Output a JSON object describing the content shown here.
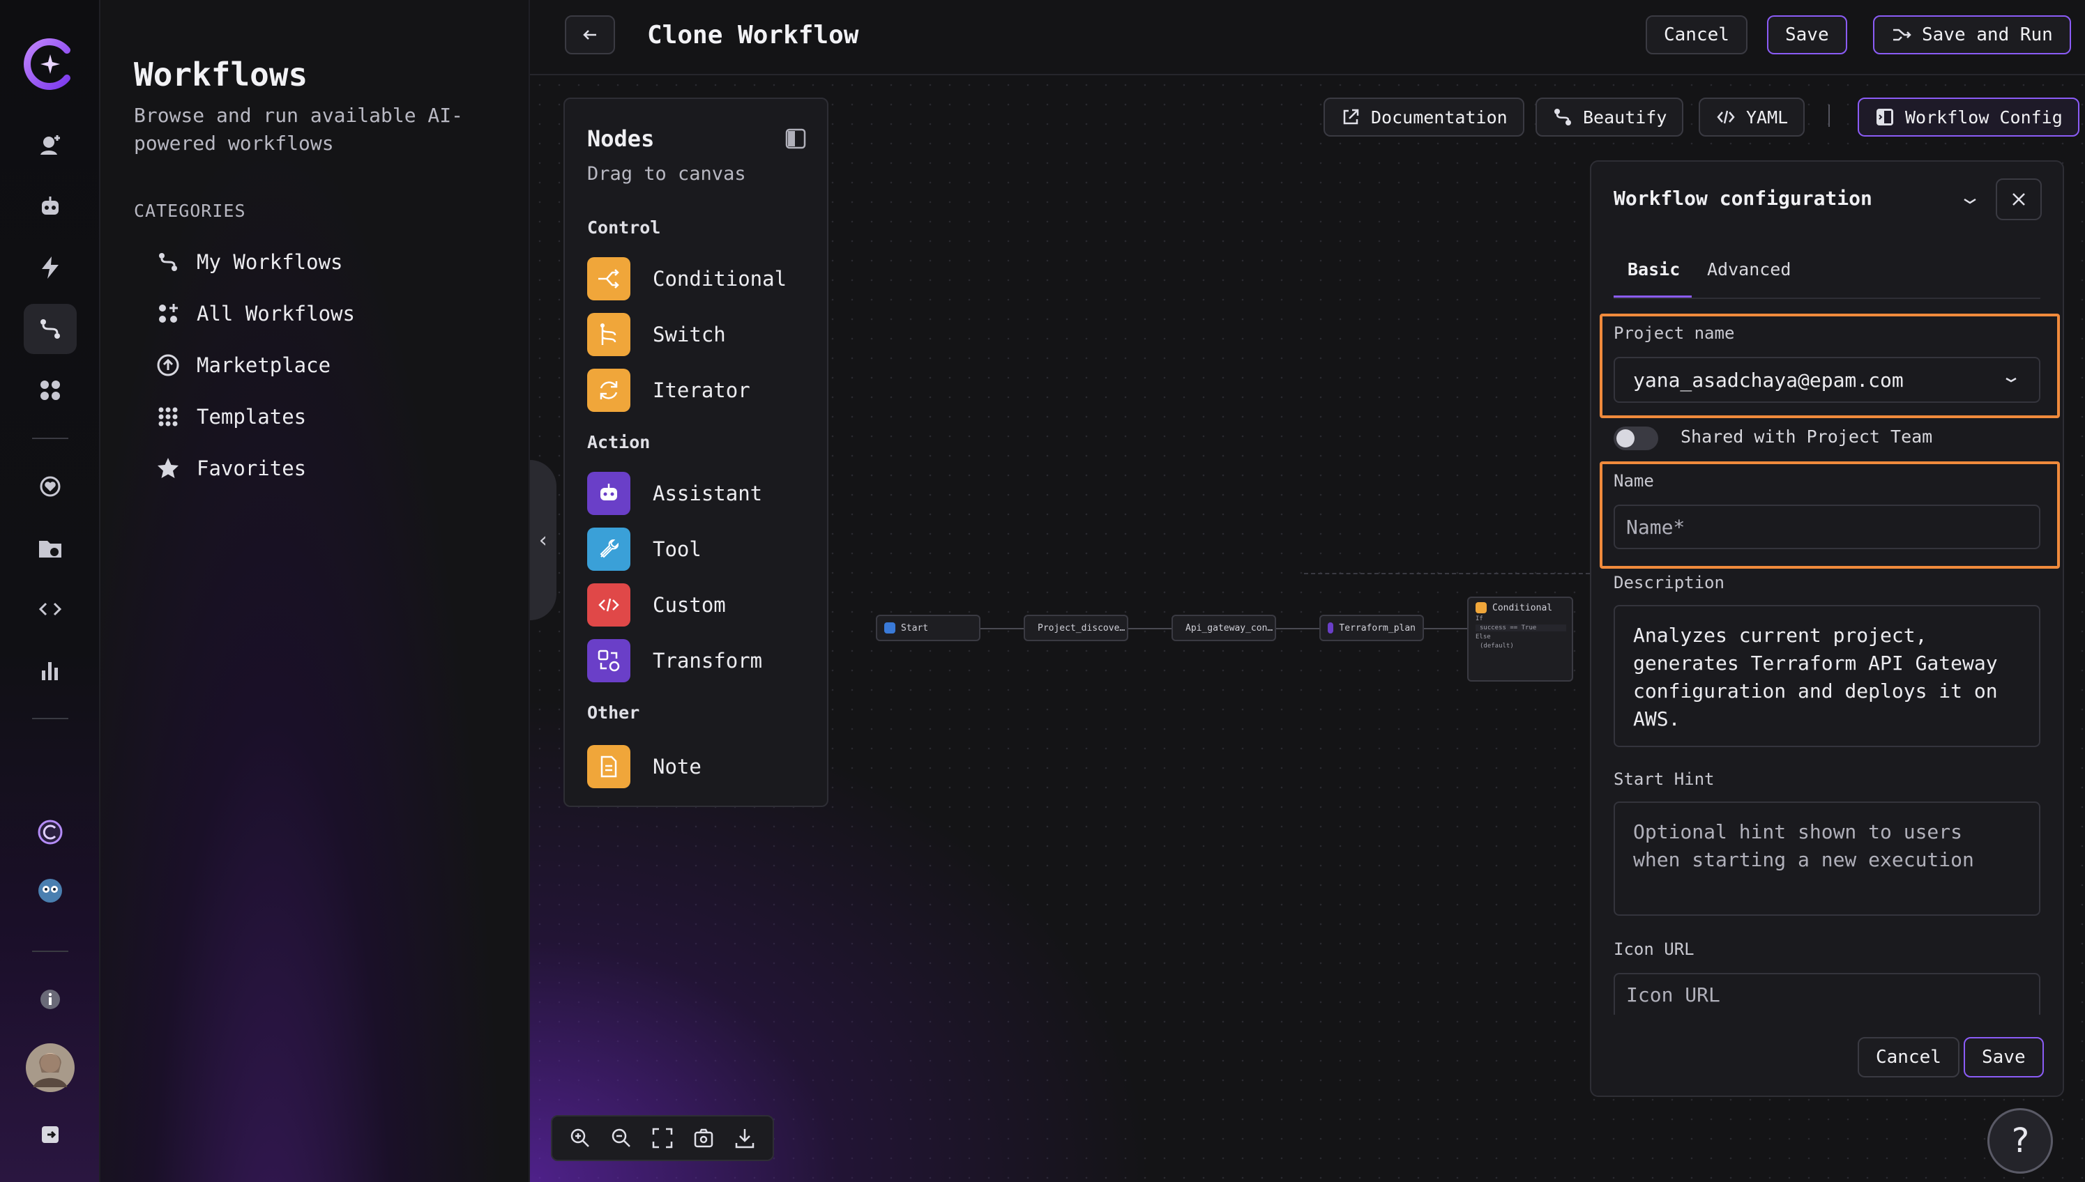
{
  "sidebar": {
    "title": "Workflows",
    "subtitle": "Browse and run available AI-powered workflows",
    "categories_heading": "CATEGORIES",
    "items": [
      {
        "label": "My Workflows",
        "icon": "my-workflows-icon"
      },
      {
        "label": "All Workflows",
        "icon": "all-workflows-icon"
      },
      {
        "label": "Marketplace",
        "icon": "marketplace-icon"
      },
      {
        "label": "Templates",
        "icon": "templates-icon"
      },
      {
        "label": "Favorites",
        "icon": "star-icon"
      }
    ]
  },
  "header": {
    "title": "Clone Workflow",
    "cancel_label": "Cancel",
    "save_label": "Save",
    "save_run_label": "Save and Run"
  },
  "toolbar": {
    "documentation": "Documentation",
    "beautify": "Beautify",
    "yaml": "YAML",
    "workflow_config": "Workflow Config"
  },
  "nodes_panel": {
    "title": "Nodes",
    "subtitle": "Drag to canvas",
    "sections": [
      {
        "name": "Control",
        "items": [
          "Conditional",
          "Switch",
          "Iterator"
        ]
      },
      {
        "name": "Action",
        "items": [
          "Assistant",
          "Tool",
          "Custom",
          "Transform"
        ]
      },
      {
        "name": "Other",
        "items": [
          "Note"
        ]
      }
    ]
  },
  "workflow": {
    "nodes": [
      "Start",
      "Project_discove…",
      "Api_gateway_con…",
      "Terraform_plan",
      "Conditional"
    ],
    "conditional_rows": [
      "If",
      "success == True",
      "Else",
      "(default)"
    ]
  },
  "config": {
    "title": "Workflow configuration",
    "tabs": [
      "Basic",
      "Advanced"
    ],
    "project_name_label": "Project name",
    "project_name_value": "yana_asadchaya@epam.com",
    "shared_label": "Shared with Project Team",
    "name_label": "Name",
    "name_placeholder": "Name*",
    "description_label": "Description",
    "description_value": "Analyzes current project, generates Terraform API Gateway configuration and deploys it on AWS.",
    "start_hint_label": "Start Hint",
    "start_hint_placeholder": "Optional hint shown to users when starting a new execution",
    "icon_url_label": "Icon URL",
    "icon_url_placeholder": "Icon URL",
    "cancel_label": "Cancel",
    "save_label": "Save"
  },
  "help": "?",
  "colors": {
    "accent": "#8b5cf6",
    "highlight": "#f08a3c",
    "node_orange": "#f0a63a"
  }
}
